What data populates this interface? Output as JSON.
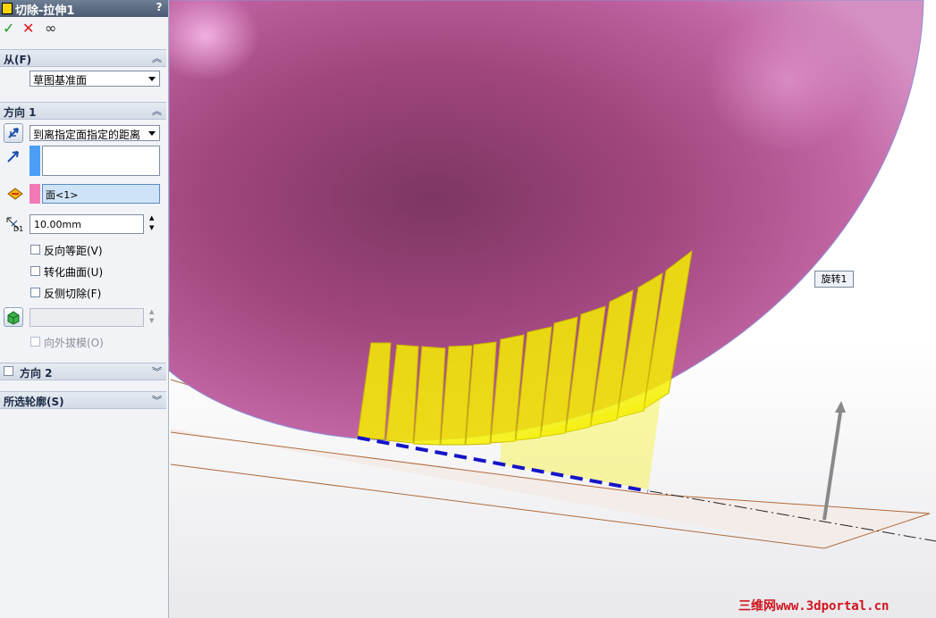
{
  "panel": {
    "title": "切除-拉伸1",
    "help": "?",
    "actions": {
      "ok": "✓",
      "cancel": "✕",
      "preview": "∞"
    },
    "from": {
      "title": "从(F)",
      "value": "草图基准面"
    },
    "direction1": {
      "title": "方向 1",
      "end_condition": "到离指定面指定的距离",
      "face": "面<1>",
      "distance": "10.00mm",
      "dim_label": "D1",
      "reverse_offset": "反向等距(V)",
      "translate_surface": "转化曲面(U)",
      "flip_side": "反侧切除(F)",
      "draft_outward": "向外拔模(O)"
    },
    "direction2": {
      "title": "方向 2"
    },
    "selected_contours": {
      "title": "所选轮廓(S)"
    }
  },
  "viewport": {
    "tooltip": "旋转1",
    "watermark": "三维网www.3dportal.cn"
  },
  "colors": {
    "sphere": "#b04a86",
    "cut_preview": "#f0f000",
    "sketch_plane": "#a0522d",
    "accent_blue": "#4a9ff5",
    "accent_pink": "#f27ab5"
  }
}
